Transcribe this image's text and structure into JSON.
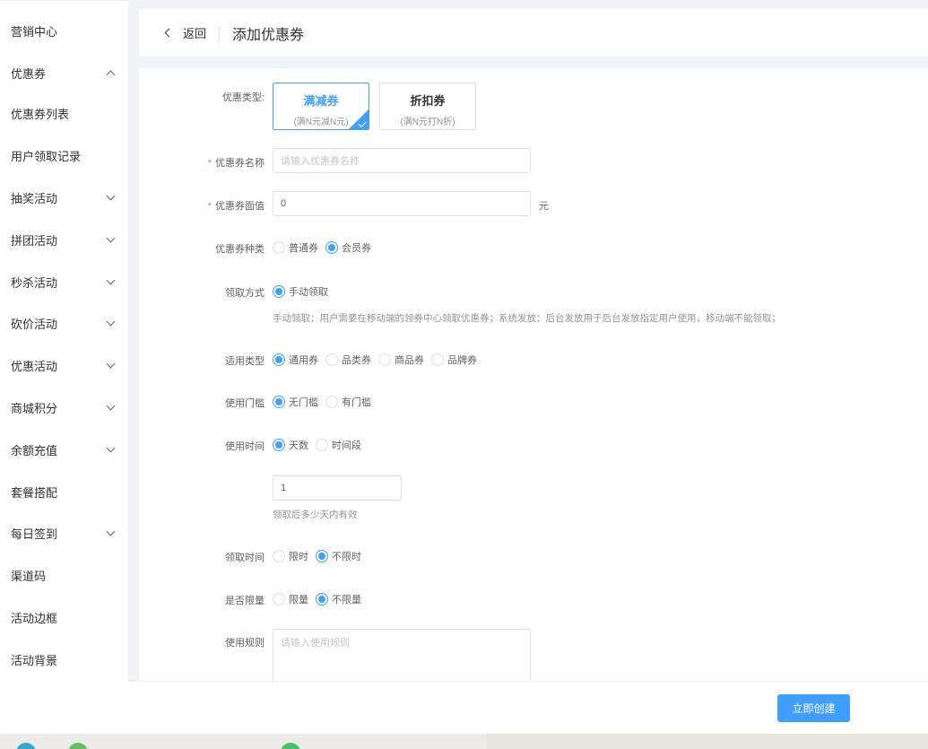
{
  "sidebar": {
    "items": [
      {
        "label": "营销中心",
        "chevron": ""
      },
      {
        "label": "优惠券",
        "chevron": "up"
      },
      {
        "label": "优惠券列表",
        "chevron": ""
      },
      {
        "label": "用户领取记录",
        "chevron": ""
      },
      {
        "label": "抽奖活动",
        "chevron": "down"
      },
      {
        "label": "拼团活动",
        "chevron": "down"
      },
      {
        "label": "秒杀活动",
        "chevron": "down"
      },
      {
        "label": "砍价活动",
        "chevron": "down"
      },
      {
        "label": "优惠活动",
        "chevron": "down"
      },
      {
        "label": "商城积分",
        "chevron": "down"
      },
      {
        "label": "余额充值",
        "chevron": "down"
      },
      {
        "label": "套餐搭配",
        "chevron": ""
      },
      {
        "label": "每日签到",
        "chevron": "down"
      },
      {
        "label": "渠道码",
        "chevron": ""
      },
      {
        "label": "活动边框",
        "chevron": ""
      },
      {
        "label": "活动背景",
        "chevron": ""
      }
    ]
  },
  "header": {
    "back_label": "返回",
    "title": "添加优惠券"
  },
  "form": {
    "coupon_type": {
      "label": "优惠类型:",
      "options": [
        {
          "title": "满减券",
          "desc": "(满N元减N元)",
          "selected": true
        },
        {
          "title": "折扣券",
          "desc": "(满N元打N折)",
          "selected": false
        }
      ]
    },
    "coupon_name": {
      "label": "优惠券名称",
      "required": true,
      "value": "",
      "placeholder": "请输入优惠券名称"
    },
    "coupon_value": {
      "label": "优惠券面值",
      "required": true,
      "value": "0",
      "unit": "元"
    },
    "coupon_kind": {
      "label": "优惠券种类",
      "options": [
        {
          "text": "普通券",
          "checked": false
        },
        {
          "text": "会员券",
          "checked": true
        }
      ]
    },
    "claim_method": {
      "label": "领取方式",
      "options": [
        {
          "text": "手动领取",
          "checked": true
        }
      ],
      "help": "手动领取：用户需要在移动端的领券中心领取优惠券；系统发放：后台发放用于后台发放指定用户使用，移动端不能领取；"
    },
    "apply_type": {
      "label": "适用类型",
      "options": [
        {
          "text": "通用券",
          "checked": true
        },
        {
          "text": "品类券",
          "checked": false
        },
        {
          "text": "商品券",
          "checked": false
        },
        {
          "text": "品牌券",
          "checked": false
        }
      ]
    },
    "threshold": {
      "label": "使用门槛",
      "options": [
        {
          "text": "无门槛",
          "checked": true
        },
        {
          "text": "有门槛",
          "checked": false
        }
      ]
    },
    "use_time": {
      "label": "使用时间",
      "options": [
        {
          "text": "天数",
          "checked": true
        },
        {
          "text": "时间段",
          "checked": false
        }
      ],
      "days_value": "1",
      "days_help": "领取后多少天内有效"
    },
    "claim_time": {
      "label": "领取时间",
      "options": [
        {
          "text": "限时",
          "checked": false
        },
        {
          "text": "不限时",
          "checked": true
        }
      ]
    },
    "limit": {
      "label": "是否限量",
      "options": [
        {
          "text": "限量",
          "checked": false
        },
        {
          "text": "不限量",
          "checked": true
        }
      ]
    },
    "rules": {
      "label": "使用规则",
      "value": "",
      "placeholder": "请输入使用规则"
    }
  },
  "footer": {
    "create_label": "立即创建"
  },
  "colors": {
    "accent": "#409eff",
    "required": "#f56c6c"
  }
}
